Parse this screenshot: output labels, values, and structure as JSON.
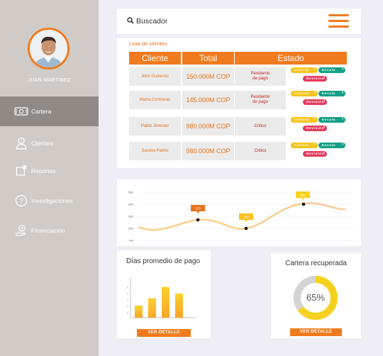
{
  "sidebar": {
    "user_name": "JUAN MARTINEZ",
    "items": [
      {
        "label": "Cartera",
        "icon": "money-icon",
        "active": true
      },
      {
        "label": "Clientes",
        "icon": "user-icon",
        "active": false
      },
      {
        "label": "Reportes",
        "icon": "report-icon",
        "active": false
      },
      {
        "label": "Investigaciones",
        "icon": "question-icon",
        "active": false
      },
      {
        "label": "Financiación",
        "icon": "finance-icon",
        "active": false
      }
    ]
  },
  "topbar": {
    "search_label": "Buscador"
  },
  "clients": {
    "title": "Lista de clientes",
    "headers": [
      "Cliente",
      "Total",
      "Estado"
    ],
    "rows": [
      {
        "name": "John Gutierrez",
        "total": "150.000M COP",
        "estado": [
          "Pendiente",
          "de pago"
        ]
      },
      {
        "name": "Marta Contreras",
        "total": "145.000M COP",
        "estado": [
          "Pendiente",
          "de pago"
        ]
      },
      {
        "name": "Pablo Jimenez",
        "total": "980.000M COP",
        "estado": [
          "Critico"
        ]
      },
      {
        "name": "Sandra Patiño",
        "total": "980.000M COP",
        "estado": [
          "Critico"
        ]
      }
    ],
    "tags": {
      "control": "control",
      "escala": "Escala",
      "revision": "Revisión"
    }
  },
  "line_chart": {
    "y_ticks": [
      "500",
      "400",
      "300",
      "200",
      "100"
    ],
    "points": [
      {
        "label": "270"
      },
      {
        "label": "200"
      },
      {
        "label": "400"
      }
    ]
  },
  "bar_chart": {
    "title": "Días promedio de pago",
    "button": "VER DETALLE",
    "y_ticks": [
      "5",
      "4",
      "3",
      "2",
      "1"
    ]
  },
  "donut": {
    "title": "Cartera recuperada",
    "value": "65%",
    "fraction": 0.65,
    "button": "VER DETALLE"
  },
  "chart_data": [
    {
      "type": "line",
      "y_ticks": [
        500,
        400,
        300,
        200,
        100
      ],
      "highlighted_points": [
        270,
        200,
        400
      ],
      "ylim": [
        100,
        500
      ]
    },
    {
      "type": "bar",
      "title": "Días promedio de pago",
      "values": [
        1.5,
        2.4,
        3.8,
        3.0
      ],
      "y_ticks": [
        1,
        2,
        3,
        4,
        5
      ],
      "ylim": [
        0,
        5
      ]
    },
    {
      "type": "pie",
      "title": "Cartera recuperada",
      "values": [
        65,
        35
      ]
    }
  ],
  "colors": {
    "accent": "#f07b1f",
    "sidebar": "#d0cbc7",
    "sidebar_active": "#8f8a86",
    "bar": "#f9b62a",
    "donut_fill": "#f6d21f",
    "donut_track": "#d4d4d4"
  }
}
